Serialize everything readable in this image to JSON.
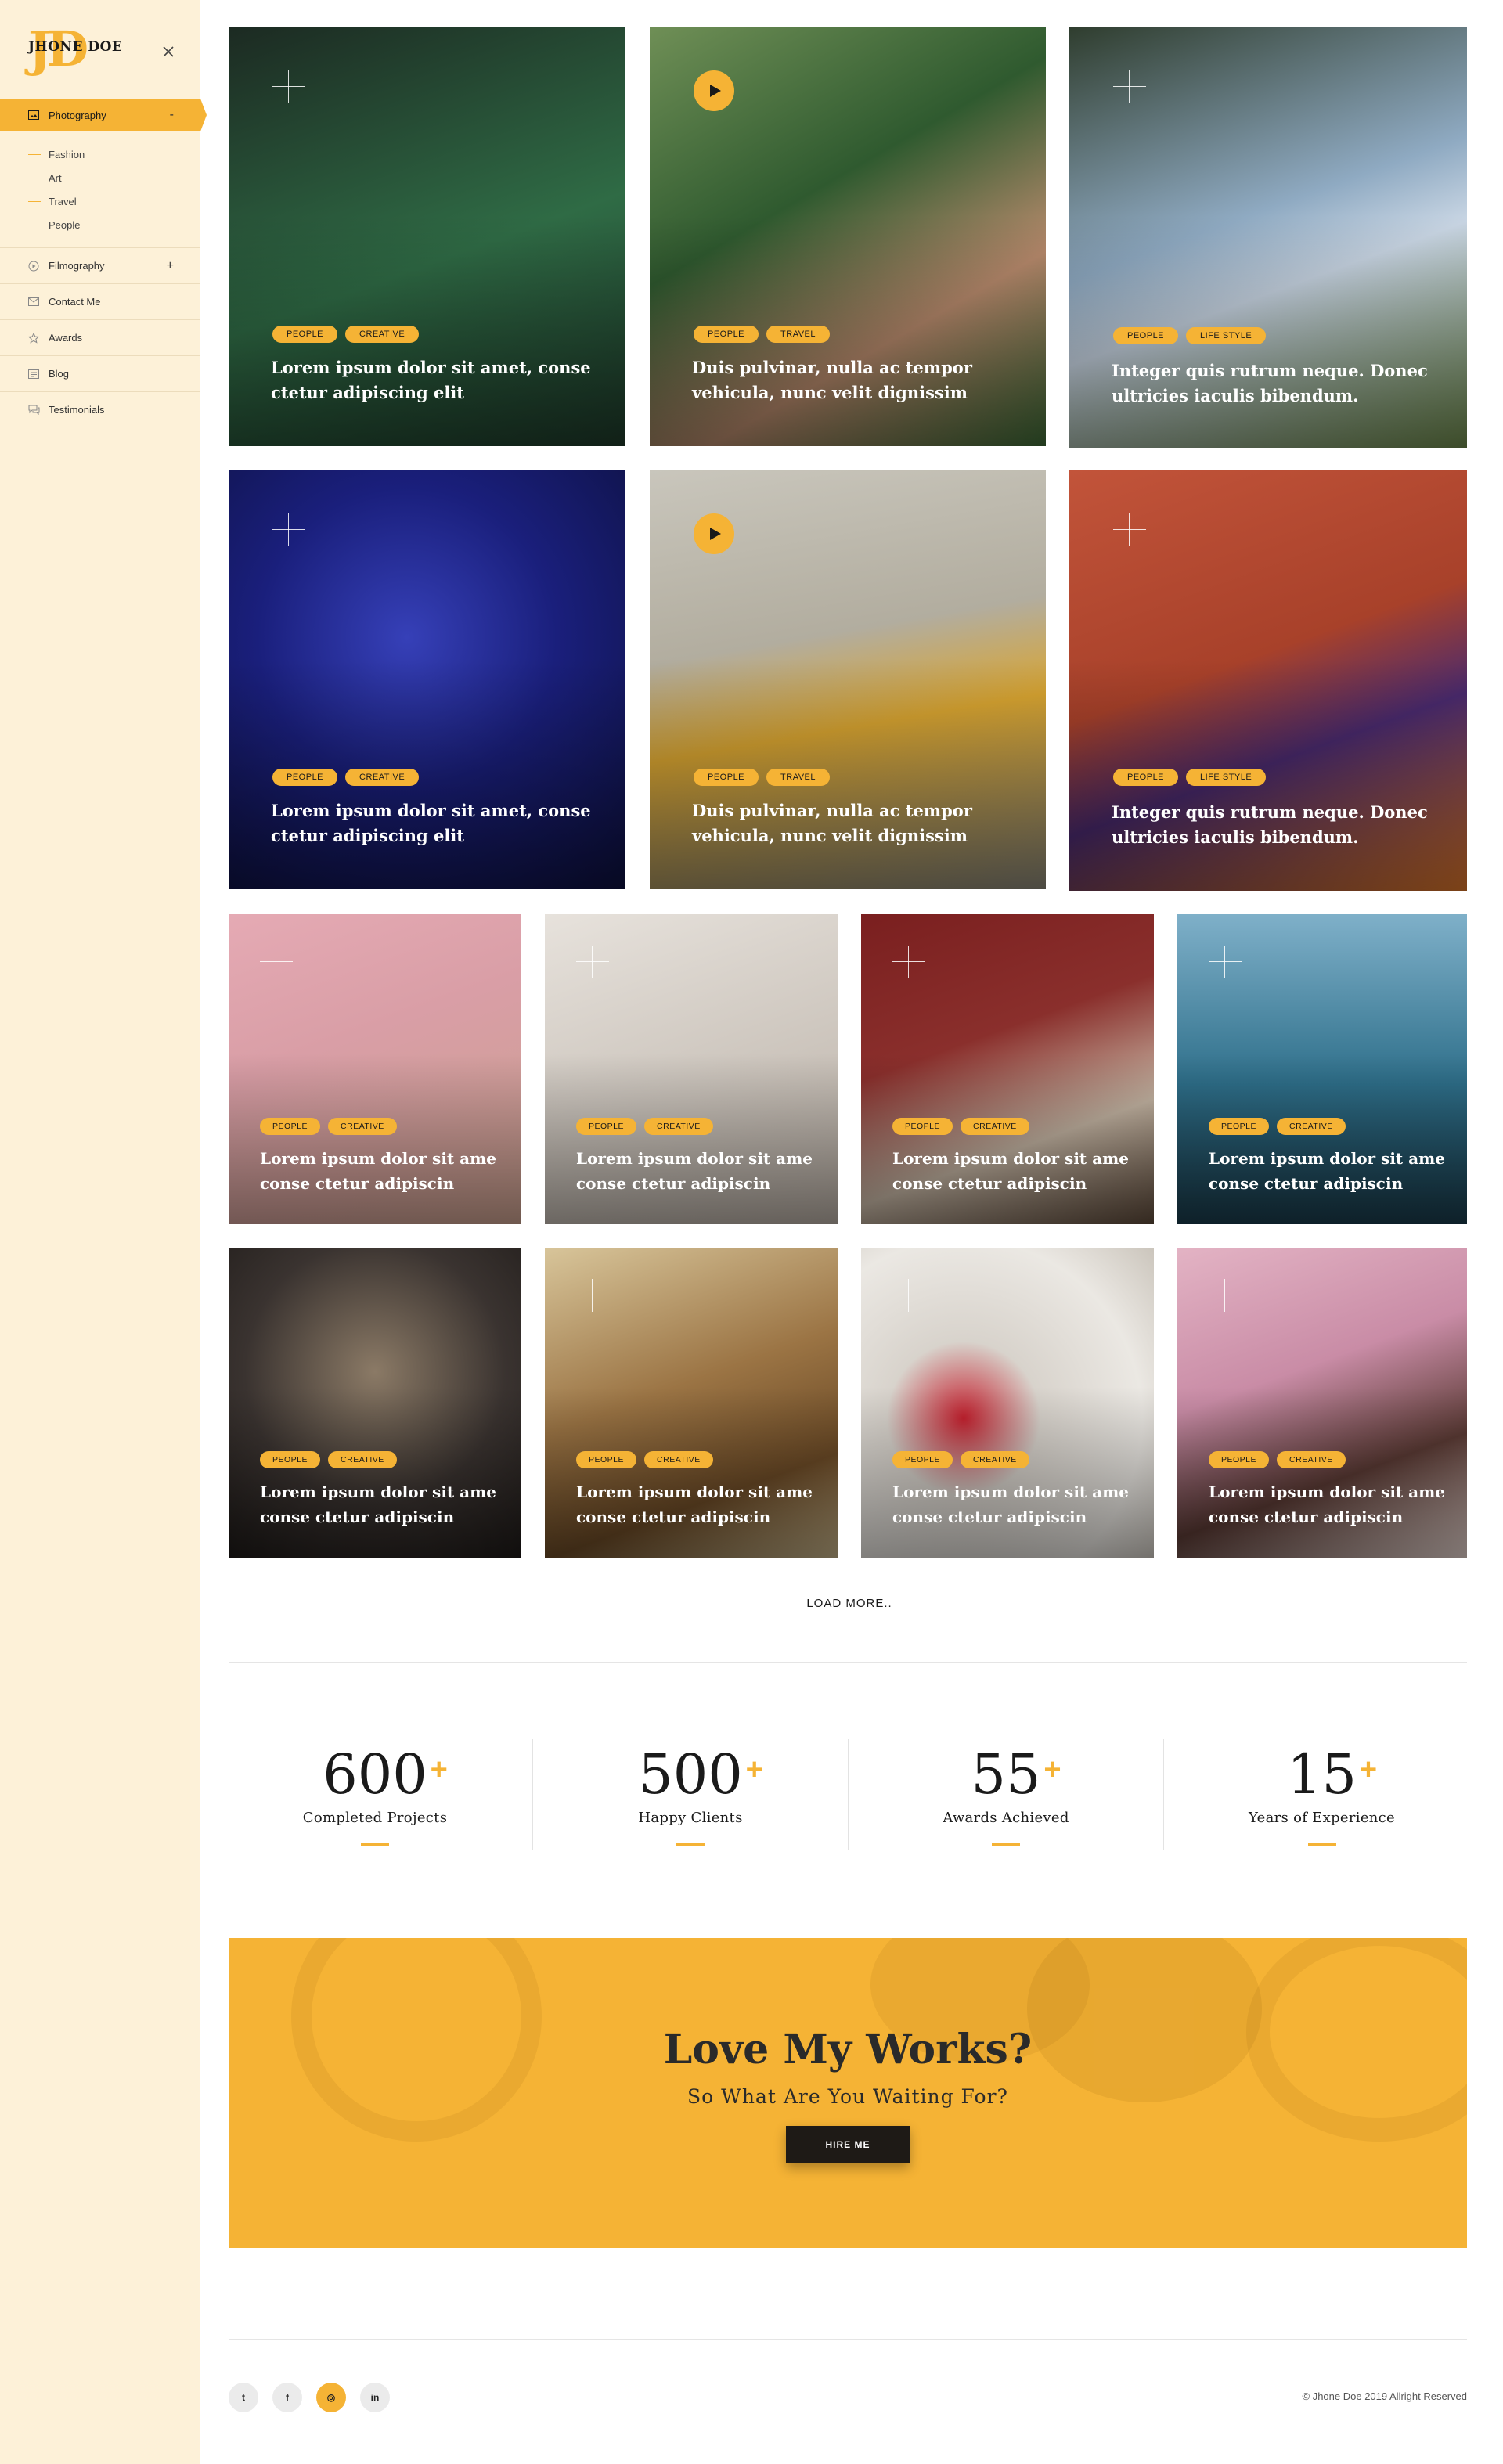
{
  "brand": {
    "monogram": "JD",
    "name": "JHONE DOE"
  },
  "sidebar": {
    "active": {
      "label": "Photography",
      "toggle": "-"
    },
    "subitems": [
      {
        "label": "Fashion"
      },
      {
        "label": "Art"
      },
      {
        "label": "Travel"
      },
      {
        "label": "People"
      }
    ],
    "items": [
      {
        "label": "Filmography",
        "toggle": "+"
      },
      {
        "label": "Contact Me"
      },
      {
        "label": "Awards"
      },
      {
        "label": "Blog"
      },
      {
        "label": "Testimonials"
      }
    ]
  },
  "gallery": {
    "large": [
      {
        "tags": [
          "PEOPLE",
          "CREATIVE"
        ],
        "caption_line1": "Lorem ipsum dolor sit amet, conse",
        "caption_line2": "ctetur adipiscing elit",
        "bg": "#2b5b3b"
      },
      {
        "tags": [
          "PEOPLE",
          "TRAVEL"
        ],
        "caption_line1": "Duis pulvinar, nulla ac tempor",
        "caption_line2": "vehicula, nunc velit dignissim",
        "bg": "#3e6a36"
      },
      {
        "tags": [
          "PEOPLE",
          "LIFE STYLE"
        ],
        "caption_line1": "Integer quis rutrum neque. Donec",
        "caption_line2": "ultricies iaculis bibendum.",
        "bg": "#58714e"
      },
      {
        "tags": [
          "PEOPLE",
          "CREATIVE"
        ],
        "caption_line1": "Lorem ipsum dolor sit amet, conse",
        "caption_line2": "ctetur adipiscing elit",
        "bg": "#1a1f7c"
      },
      {
        "tags": [
          "PEOPLE",
          "TRAVEL"
        ],
        "caption_line1": "Duis pulvinar, nulla ac tempor",
        "caption_line2": "vehicula, nunc velit dignissim",
        "bg": "#b89f6c"
      },
      {
        "tags": [
          "PEOPLE",
          "LIFE STYLE"
        ],
        "caption_line1": "Integer quis rutrum neque. Donec",
        "caption_line2": "ultricies iaculis bibendum.",
        "bg": "#b5492a"
      }
    ],
    "small": [
      {
        "tags": [
          "PEOPLE",
          "CREATIVE"
        ],
        "caption_line1": "Lorem ipsum dolor sit ame",
        "caption_line2": "conse ctetur adipiscin",
        "bg": "#d99ea6"
      },
      {
        "tags": [
          "PEOPLE",
          "CREATIVE"
        ],
        "caption_line1": "Lorem ipsum dolor sit ame",
        "caption_line2": "conse ctetur adipiscin",
        "bg": "#cfc8c0"
      },
      {
        "tags": [
          "PEOPLE",
          "CREATIVE"
        ],
        "caption_line1": "Lorem ipsum dolor sit ame",
        "caption_line2": "conse ctetur adipiscin",
        "bg": "#8a2f2c"
      },
      {
        "tags": [
          "PEOPLE",
          "CREATIVE"
        ],
        "caption_line1": "Lorem ipsum dolor sit ame",
        "caption_line2": "conse ctetur adipiscin",
        "bg": "#2e6f8a"
      },
      {
        "tags": [
          "PEOPLE",
          "CREATIVE"
        ],
        "caption_line1": "Lorem ipsum dolor sit ame",
        "caption_line2": "conse ctetur adipiscin",
        "bg": "#3a3330"
      },
      {
        "tags": [
          "PEOPLE",
          "CREATIVE"
        ],
        "caption_line1": "Lorem ipsum dolor sit ame",
        "caption_line2": "conse ctetur adipiscin",
        "bg": "#9b7444"
      },
      {
        "tags": [
          "PEOPLE",
          "CREATIVE"
        ],
        "caption_line1": "Lorem ipsum dolor sit ame",
        "caption_line2": "conse ctetur adipiscin",
        "bg": "#d8d3cc"
      },
      {
        "tags": [
          "PEOPLE",
          "CREATIVE"
        ],
        "caption_line1": "Lorem ipsum dolor sit ame",
        "caption_line2": "conse ctetur adipiscin",
        "bg": "#c98ca6"
      }
    ]
  },
  "load_more": "LOAD MORE..",
  "stats": [
    {
      "value": "600",
      "suffix": "+",
      "label": "Completed Projects"
    },
    {
      "value": "500",
      "suffix": "+",
      "label": "Happy Clients"
    },
    {
      "value": "55",
      "suffix": "+",
      "label": "Awards Achieved"
    },
    {
      "value": "15",
      "suffix": "+",
      "label": "Years of Experience"
    }
  ],
  "cta": {
    "title": "Love My Works?",
    "subtitle": "So What Are You Waiting For?",
    "button": "HIRE ME"
  },
  "footer": {
    "socials": [
      {
        "name": "twitter-icon",
        "glyph": "t"
      },
      {
        "name": "facebook-icon",
        "glyph": "f"
      },
      {
        "name": "instagram-icon",
        "glyph": "◎"
      },
      {
        "name": "linkedin-icon",
        "glyph": "in"
      }
    ],
    "copyright": "© Jhone Doe 2019 Allright Reserved"
  },
  "colors": {
    "accent": "#f5b335",
    "sidebar_bg": "#fdf1d8",
    "dark": "#1e1a16"
  }
}
